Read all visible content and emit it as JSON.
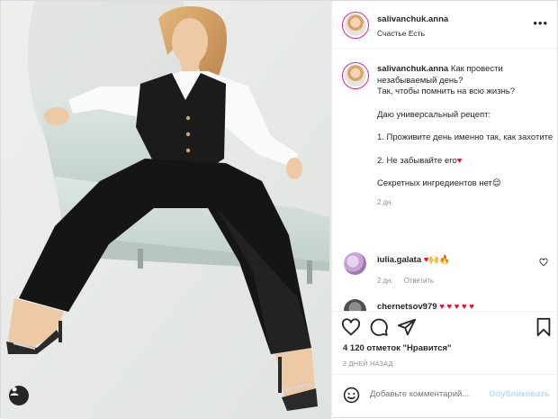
{
  "header": {
    "username": "salivanchuk.anna",
    "location": "Счастье Есть",
    "more_label": "•••"
  },
  "caption": {
    "username": "salivanchuk.anna",
    "lines": [
      "Как провести незабываемый день?",
      "Так, чтобы помнить на всю жизнь?",
      "",
      "Даю универсальный рецепт:",
      "",
      "1. Проживите день именно так, как захотите",
      "",
      "2. Не забывайте его",
      "",
      "Секретных ингредиентов нет"
    ],
    "heart_emoji": "♥",
    "face_emoji": "😌",
    "time": "2 дн."
  },
  "comments": [
    {
      "username": "iulia.galata",
      "text": "♥🙌🔥",
      "time": "2 дн.",
      "reply_label": "Ответить"
    },
    {
      "username": "chernetsov979",
      "text": "♥ ♥ ♥ ♥ ♥"
    }
  ],
  "likes": "4 120 отметок \"Нравится\"",
  "date": "2 ДНЕЙ НАЗАД",
  "add_comment": {
    "placeholder": "Добавьте комментарий...",
    "publish_label": "Опубликовать"
  },
  "colors": {
    "accent_disabled": "#b2dffc",
    "heart": "#e0102e",
    "muted": "#8e8e8e"
  },
  "icons": [
    "user-tag-icon",
    "more-icon",
    "like-icon",
    "comment-icon",
    "share-icon",
    "save-icon",
    "emoji-icon"
  ]
}
